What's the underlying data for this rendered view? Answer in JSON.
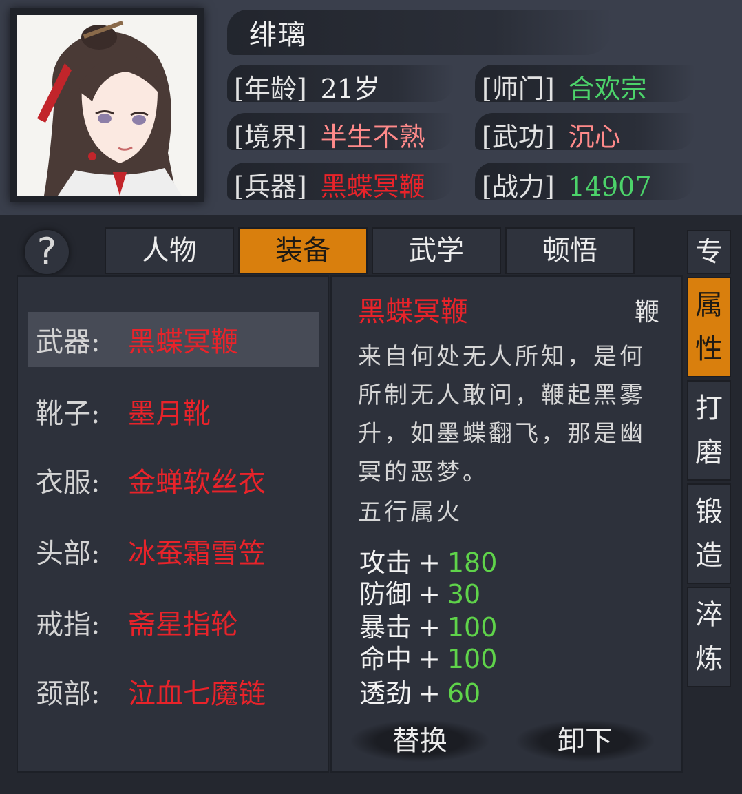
{
  "character": {
    "name": "绯璃",
    "age_label": "[年龄]",
    "age": "21岁",
    "sect_label": "[师门]",
    "sect": "合欢宗",
    "realm_label": "[境界]",
    "realm": "半生不熟",
    "skill_label": "[武功]",
    "skill": "沉心",
    "weapon_label": "[兵器]",
    "weapon": "黑蝶冥鞭",
    "power_label": "[战力]",
    "power": "14907"
  },
  "help_icon": "?",
  "tabs": [
    {
      "label": "人物",
      "active": false
    },
    {
      "label": "装备",
      "active": true
    },
    {
      "label": "武学",
      "active": false
    },
    {
      "label": "顿悟",
      "active": false
    }
  ],
  "equipment": [
    {
      "label": "武器:",
      "value": "黑蝶冥鞭",
      "selected": true
    },
    {
      "label": "靴子:",
      "value": "墨月靴"
    },
    {
      "label": "衣服:",
      "value": "金蝉软丝衣"
    },
    {
      "label": "头部:",
      "value": "冰蚕霜雪笠"
    },
    {
      "label": "戒指:",
      "value": "斋星指轮"
    },
    {
      "label": "颈部:",
      "value": "泣血七魔链"
    }
  ],
  "item_detail": {
    "name": "黑蝶冥鞭",
    "type": "鞭",
    "description": "来自何处无人所知，是何所制无人敢问，鞭起黑雾升，如墨蝶翻飞，那是幽冥的恶梦。",
    "element": "五行属火",
    "bonuses": [
      {
        "stat": "攻击",
        "sign": "+",
        "value": "180"
      },
      {
        "stat": "防御",
        "sign": "+",
        "value": "30"
      },
      {
        "stat": "暴击",
        "sign": "+",
        "value": "100"
      },
      {
        "stat": "命中",
        "sign": "+",
        "value": "100"
      },
      {
        "stat": "透劲",
        "sign": "+",
        "value": "60"
      }
    ],
    "replace_label": "替换",
    "unequip_label": "卸下"
  },
  "side_tabs": [
    {
      "chars": [
        "专",
        "属"
      ],
      "active": true
    },
    {
      "chars": [
        "性"
      ],
      "active": false
    },
    {
      "chars": [
        "打",
        "磨"
      ],
      "active": false
    },
    {
      "chars": [
        "锻",
        "造"
      ],
      "active": false
    },
    {
      "chars": [
        "淬",
        "炼"
      ],
      "active": false
    }
  ],
  "colors": {
    "accent_orange": "#d97f0d",
    "item_red": "#e8232a",
    "stat_green": "#5fd34a",
    "realm_pink": "#ff8a8a"
  }
}
